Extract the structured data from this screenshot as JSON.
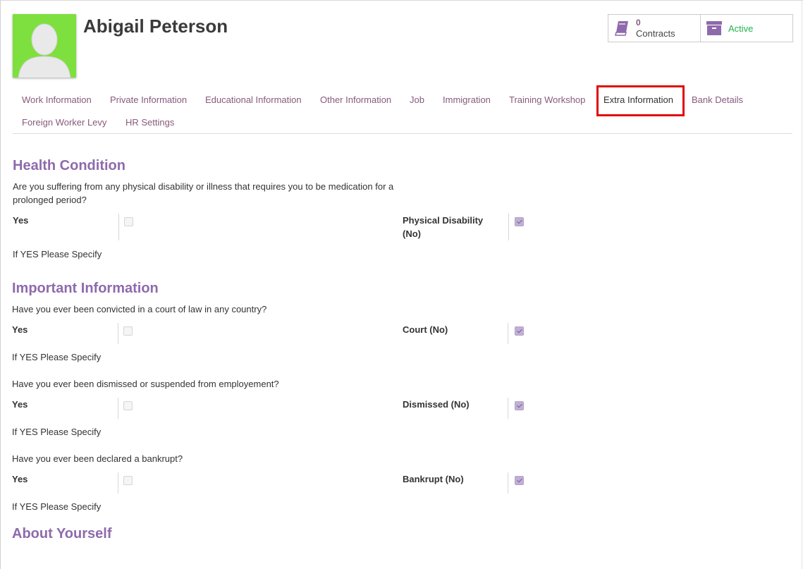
{
  "employee": {
    "name": "Abigail Peterson"
  },
  "stats": {
    "contracts_count": "0",
    "contracts_label": "Contracts",
    "status_label": "Active"
  },
  "tabs": [
    {
      "label": "Work Information"
    },
    {
      "label": "Private Information"
    },
    {
      "label": "Educational Information"
    },
    {
      "label": "Other Information"
    },
    {
      "label": "Job"
    },
    {
      "label": "Immigration"
    },
    {
      "label": "Training Workshop"
    },
    {
      "label": "Extra Information",
      "selected": true
    },
    {
      "label": "Bank Details"
    },
    {
      "label": "Foreign Worker Levy"
    },
    {
      "label": "HR Settings"
    }
  ],
  "health": {
    "title": "Health Condition",
    "question_line1": "Are you suffering from any physical disability or illness that requires you to be medication for a",
    "question_line2": "prolonged period?",
    "yes_label": "Yes",
    "yes_checked": false,
    "right_label_line1": "Physical Disability",
    "right_label_line2": "(No)",
    "no_checked": true,
    "specify_label": "If YES Please Specify"
  },
  "important": {
    "title": "Important Information",
    "items": [
      {
        "question": "Have you ever been convicted in a court of law in any country?",
        "yes_label": "Yes",
        "yes_checked": false,
        "right_label": "Court (No)",
        "no_checked": true,
        "specify_label": "If YES Please Specify"
      },
      {
        "question": "Have you ever been dismissed or suspended from employement?",
        "yes_label": "Yes",
        "yes_checked": false,
        "right_label": "Dismissed (No)",
        "no_checked": true,
        "specify_label": "If YES Please Specify"
      },
      {
        "question": "Have you ever been declared a bankrupt?",
        "yes_label": "Yes",
        "yes_checked": false,
        "right_label": "Bankrupt (No)",
        "no_checked": true,
        "specify_label": "If YES Please Specify"
      }
    ]
  },
  "about": {
    "title": "About Yourself"
  },
  "colors": {
    "accent": "#875a7b",
    "section_title": "#8e6aac",
    "active_status": "#21b24a",
    "avatar_bg": "#7ee03f",
    "highlight": "#e00a0a"
  },
  "icons": [
    "person-silhouette-icon",
    "book-icon",
    "archive-box-icon",
    "checkbox-icon"
  ]
}
